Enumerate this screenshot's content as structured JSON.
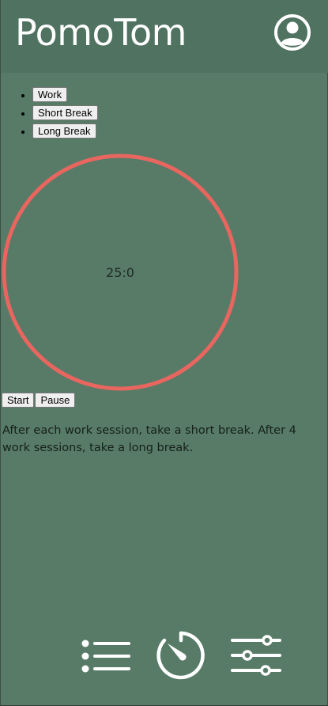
{
  "header": {
    "title": "PomoTom",
    "profile_icon": "user-circle-icon"
  },
  "modes": [
    {
      "label": "Work"
    },
    {
      "label": "Short Break"
    },
    {
      "label": "Long Break"
    }
  ],
  "timer": {
    "display": "25:0",
    "ring_color": "#e8665f"
  },
  "controls": {
    "start_label": "Start",
    "pause_label": "Pause"
  },
  "info": {
    "text": "After each work session, take a short break. After 4 work sessions, take a long break."
  },
  "nav": {
    "items": [
      {
        "icon": "list-icon"
      },
      {
        "icon": "timer-icon"
      },
      {
        "icon": "settings-sliders-icon"
      }
    ]
  },
  "colors": {
    "background": "#577b67",
    "header": "#4f7261",
    "accent": "#e8665f"
  }
}
